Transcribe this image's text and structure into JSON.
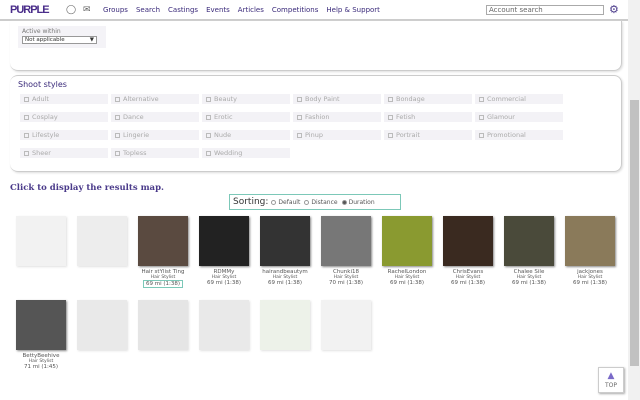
{
  "nav": {
    "logo": "PURPLE",
    "chat_icon": "chat-icon",
    "mail_icon": "mail-icon",
    "links": [
      "Groups",
      "Search",
      "Castings",
      "Events",
      "Articles",
      "Competitions",
      "Help & Support"
    ],
    "search_placeholder": "Account search"
  },
  "filters": {
    "active_within_label": "Active within",
    "active_within_value": "Not applicable",
    "shoot_styles_label": "Shoot styles",
    "styles": [
      "Adult",
      "Alternative",
      "Beauty",
      "Body Paint",
      "Bondage",
      "Commercial",
      "Cosplay",
      "Dance",
      "Erotic",
      "Fashion",
      "Fetish",
      "Glamour",
      "Lifestyle",
      "Lingerie",
      "Nude",
      "Pinup",
      "Portrait",
      "Promotional",
      "Sheer",
      "Topless",
      "Wedding"
    ]
  },
  "map_link": "Click to display the results map.",
  "sorting": {
    "label": "Sorting:",
    "options": [
      "Default",
      "Distance",
      "Duration"
    ],
    "selected": "Duration"
  },
  "results": [
    {
      "name": "",
      "role": "",
      "dist": "",
      "faded": true,
      "color": "#ccc"
    },
    {
      "name": "",
      "role": "",
      "dist": "",
      "faded": true,
      "color": "#bbb"
    },
    {
      "name": "Hair stYlist Ting",
      "role": "Hair Stylist",
      "dist": "69 mi (1:38)",
      "highlight": true,
      "color": "#5a4a40"
    },
    {
      "name": "RDMMy",
      "role": "Hair Stylist",
      "dist": "69 mi (1:38)",
      "color": "#222"
    },
    {
      "name": "hairandbeautym",
      "role": "Hair Stylist",
      "dist": "69 mi (1:38)",
      "color": "#333"
    },
    {
      "name": "Chunki18",
      "role": "Hair Stylist",
      "dist": "70 mi (1:38)",
      "color": "#777"
    },
    {
      "name": "RachelLondon",
      "role": "Hair Stylist",
      "dist": "69 mi (1:38)",
      "color": "#8a9a30"
    },
    {
      "name": "ChrisEvans",
      "role": "Hair Stylist",
      "dist": "69 mi (1:38)",
      "color": "#3a2a20"
    },
    {
      "name": "Chalee Sile",
      "role": "Hair Stylist",
      "dist": "69 mi (1:38)",
      "color": "#4a4a3a"
    },
    {
      "name": "jackjones",
      "role": "Hair Stylist",
      "dist": "69 mi (1:38)",
      "color": "#8a7a5a"
    },
    {
      "name": "BettyBeehive",
      "role": "Hair Stylist",
      "dist": "71 mi (1:45)",
      "color": "#555"
    },
    {
      "name": "",
      "role": "",
      "dist": "",
      "faded": true,
      "color": "#aaa"
    },
    {
      "name": "",
      "role": "",
      "dist": "",
      "faded": true,
      "color": "#999"
    },
    {
      "name": "",
      "role": "",
      "dist": "",
      "faded": true,
      "color": "#aaa"
    },
    {
      "name": "",
      "role": "",
      "dist": "",
      "faded": true,
      "color": "#bca"
    },
    {
      "name": "",
      "role": "",
      "dist": "",
      "faded": true,
      "color": "#ccc"
    }
  ],
  "top_button": "TOP"
}
